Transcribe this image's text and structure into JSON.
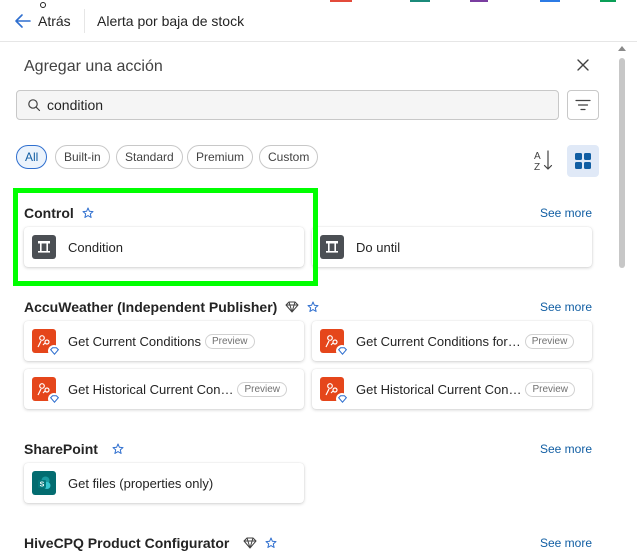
{
  "header": {
    "back_label": "Atrás",
    "flow_title": "Alerta por baja de stock"
  },
  "panel": {
    "title": "Agregar una acción",
    "search_value": "condition"
  },
  "filters": [
    {
      "label": "All",
      "active": true
    },
    {
      "label": "Built-in",
      "active": false
    },
    {
      "label": "Standard",
      "active": false
    },
    {
      "label": "Premium",
      "active": false
    },
    {
      "label": "Custom",
      "active": false
    }
  ],
  "see_more_label": "See more",
  "preview_label": "Preview",
  "sections": [
    {
      "title": "Control",
      "actions": [
        {
          "label": "Condition",
          "icon": "condition-icon"
        },
        {
          "label": "Do until",
          "icon": "do-until-icon"
        }
      ]
    },
    {
      "title": "AccuWeather (Independent Publisher)",
      "premium": true,
      "actions": [
        {
          "label": "Get Current Conditions",
          "preview": true
        },
        {
          "label": "Get Current Conditions for…",
          "preview": true
        },
        {
          "label": "Get Historical Current Con…",
          "preview": true
        },
        {
          "label": "Get Historical Current Con…",
          "preview": true
        }
      ]
    },
    {
      "title": "SharePoint",
      "actions": [
        {
          "label": "Get files (properties only)",
          "icon": "sharepoint-icon"
        }
      ]
    },
    {
      "title": "HiveCPQ Product Configurator",
      "premium": true
    }
  ],
  "colors": {
    "accent": "#115ea3",
    "control_icon_bg": "#4b4f54",
    "accuweather_icon_bg": "#e5461b",
    "sharepoint_icon_bg": "#036c70",
    "highlight": "#00ff00"
  }
}
